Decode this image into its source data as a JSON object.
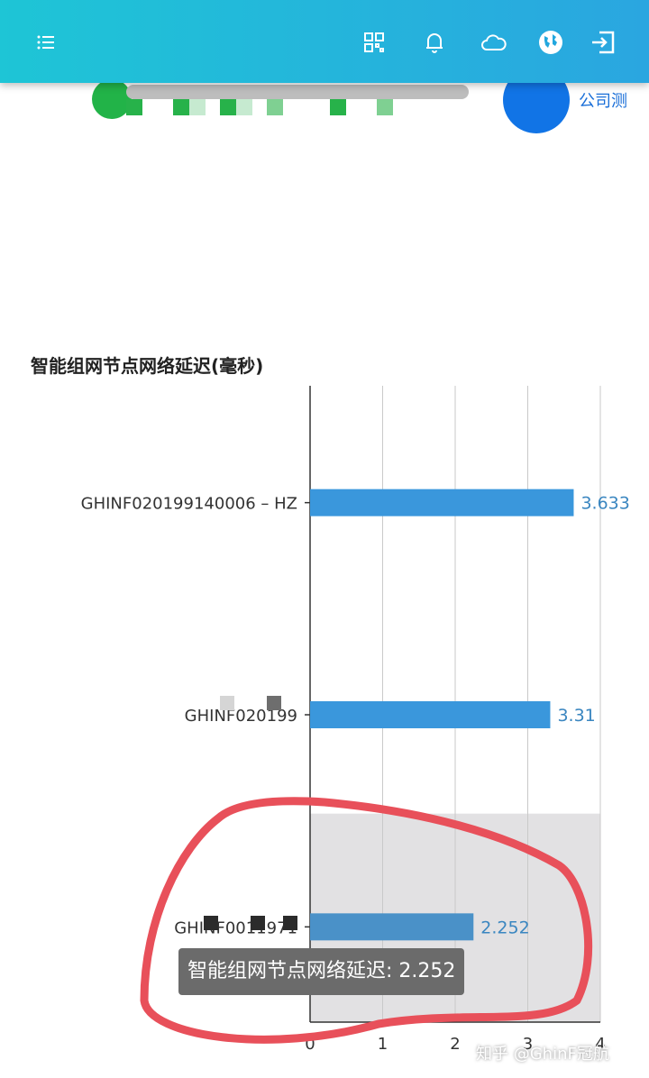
{
  "topbar": {
    "icons": [
      "menu-icon",
      "qr-code-icon",
      "bell-icon",
      "cloud-icon",
      "globe-icon",
      "exit-icon"
    ],
    "background_colors": [
      "#1ec5d6",
      "#2aa6e0"
    ]
  },
  "header": {
    "company_label": "公司测"
  },
  "chart": {
    "title": "智能组网节点网络延迟(毫秒)",
    "tooltip": "智能组网节点网络延迟: 2.252",
    "watermark": "知乎 @GhinF冠航"
  },
  "chart_data": {
    "type": "bar",
    "orientation": "horizontal",
    "title": "智能组网节点网络延迟(毫秒)",
    "categories": [
      "GHINF020199140006 – HZ",
      "GHINF020199",
      "GHINF0011971"
    ],
    "values": [
      3.633,
      3.31,
      2.252
    ],
    "value_labels": [
      "3.633",
      "3.31",
      "2.252"
    ],
    "xlim": [
      0,
      4
    ],
    "xticks": [
      "0",
      "1",
      "2",
      "3",
      "4"
    ],
    "grid": true,
    "highlighted_index": 2,
    "bar_color": "#3a97dc",
    "highlight_bar_color": "#4a91c8",
    "label_color": "#3a86c0",
    "highlight_bg": "#e2e1e3",
    "annotation_color": "#e8505a"
  }
}
